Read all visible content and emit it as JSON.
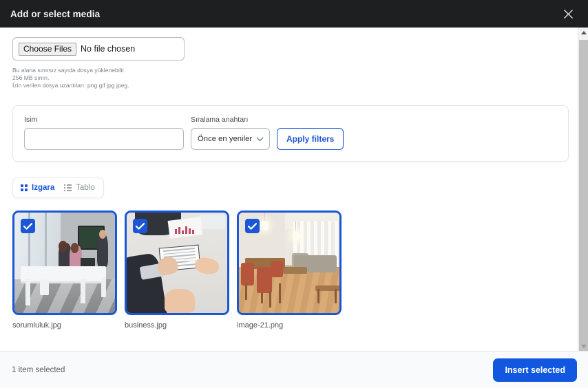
{
  "header": {
    "title": "Add or select media",
    "close_icon": "close-icon"
  },
  "upload": {
    "choose_files_label": "Choose Files",
    "no_file_text": "No file chosen",
    "help_line_1": "Bu alana sınırsız sayıda dosya yüklenebilir.",
    "help_line_2": "256 MB sınırı.",
    "help_line_3": "İzin verilen dosya uzantıları: png gif jpg jpeg."
  },
  "filters": {
    "name_label": "İsim",
    "name_value": "",
    "name_placeholder": "",
    "sort_label": "Sıralama anahtarı",
    "sort_value": "Önce en yeniler",
    "sort_options": [
      "Önce en yeniler"
    ],
    "apply_label": "Apply filters"
  },
  "view_toggle": {
    "grid_label": "Izgara",
    "grid_icon": "grid-icon",
    "table_label": "Tablo",
    "table_icon": "list-icon",
    "active": "Izgara"
  },
  "media": {
    "items": [
      {
        "name": "sorumluluk.jpg",
        "selected": true
      },
      {
        "name": "business.jpg",
        "selected": true
      },
      {
        "name": "image-21.png",
        "selected": true
      }
    ]
  },
  "footer": {
    "selection_text": "1 item selected",
    "insert_label": "Insert selected"
  },
  "colors": {
    "header_bg": "#1d1f21",
    "accent": "#1a56d6",
    "primary_button": "#1257e0",
    "footer_bg": "#f8fafc",
    "muted_text": "#7d858c"
  }
}
